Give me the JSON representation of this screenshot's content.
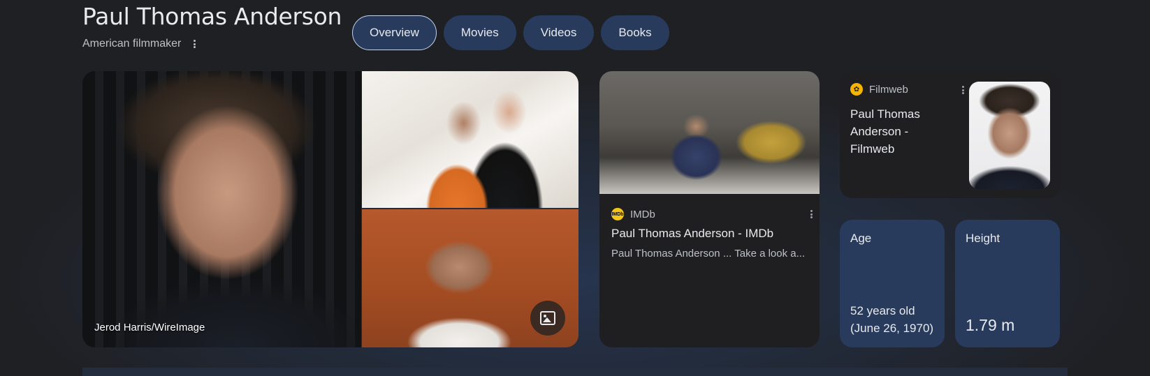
{
  "header": {
    "title": "Paul Thomas Anderson",
    "subtitle": "American filmmaker"
  },
  "tabs": [
    {
      "label": "Overview",
      "active": true
    },
    {
      "label": "Movies",
      "active": false
    },
    {
      "label": "Videos",
      "active": false
    },
    {
      "label": "Books",
      "active": false
    }
  ],
  "images": {
    "main_caption": "Jerod Harris/WireImage",
    "gallery_icon": "image-gallery-icon"
  },
  "imdb": {
    "source": "IMDb",
    "favicon_text": "IMDb",
    "title": "Paul Thomas Anderson - IMDb",
    "snippet": "Paul Thomas Anderson ... Take a look a..."
  },
  "filmweb": {
    "source": "Filmweb",
    "title": "Paul Thomas Anderson - Filmweb"
  },
  "facts": {
    "age_label": "Age",
    "age_value": "52 years old (June 26, 1970)",
    "height_label": "Height",
    "height_value": "1.79 m"
  },
  "colors": {
    "background": "#1f2024",
    "chip": "#283b5c",
    "card": "#1f1f21",
    "text": "#e8eaed",
    "muted_text": "#bdc1c6"
  }
}
